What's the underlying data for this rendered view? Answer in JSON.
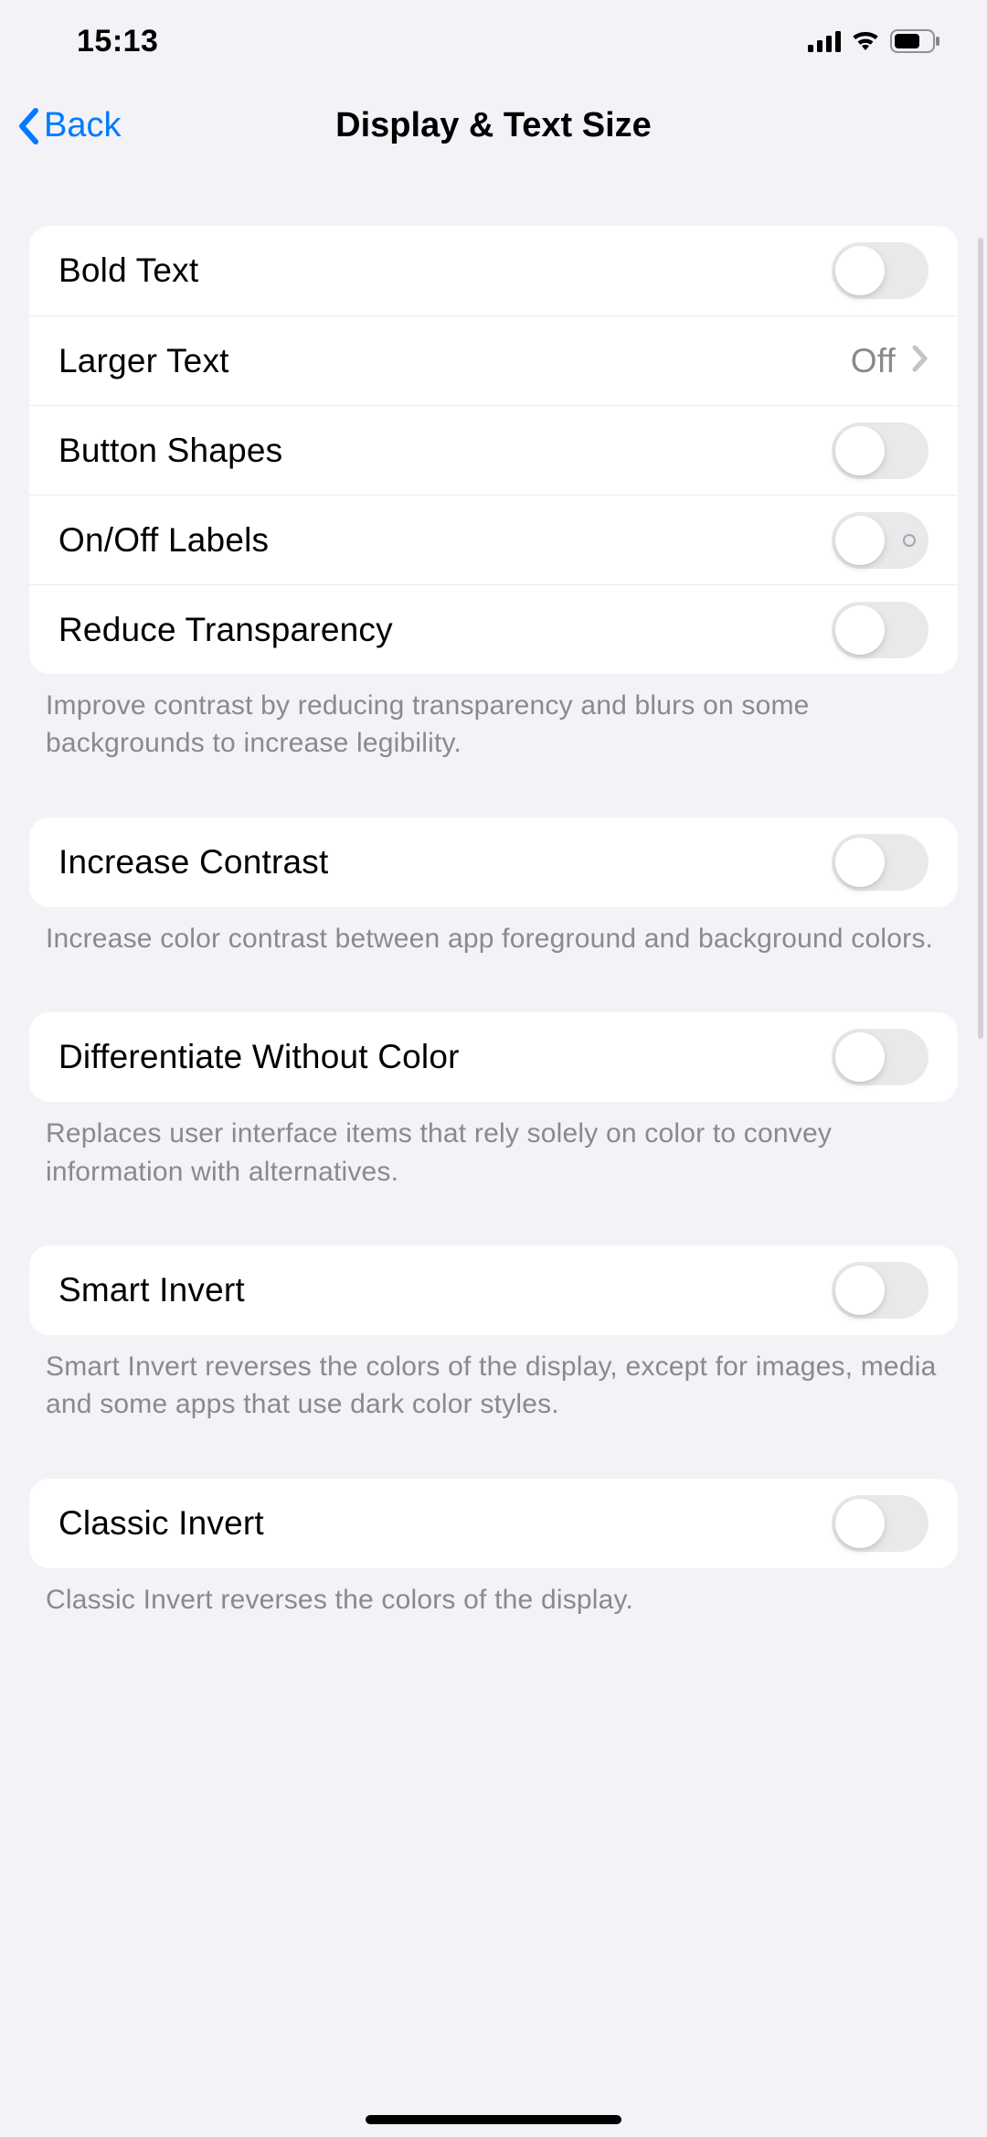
{
  "statusBar": {
    "time": "15:13"
  },
  "nav": {
    "back": "Back",
    "title": "Display & Text Size"
  },
  "group1": {
    "boldText": "Bold Text",
    "largerText": "Larger Text",
    "largerTextValue": "Off",
    "buttonShapes": "Button Shapes",
    "onOffLabels": "On/Off Labels",
    "reduceTransparency": "Reduce Transparency",
    "footer": "Improve contrast by reducing transparency and blurs on some backgrounds to increase legibility."
  },
  "group2": {
    "increaseContrast": "Increase Contrast",
    "footer": "Increase color contrast between app foreground and background colors."
  },
  "group3": {
    "differentiate": "Differentiate Without Color",
    "footer": "Replaces user interface items that rely solely on color to convey information with alternatives."
  },
  "group4": {
    "smartInvert": "Smart Invert",
    "footer": "Smart Invert reverses the colors of the display, except for images, media and some apps that use dark color styles."
  },
  "group5": {
    "classicInvert": "Classic Invert",
    "footer": "Classic Invert reverses the colors of the display."
  }
}
